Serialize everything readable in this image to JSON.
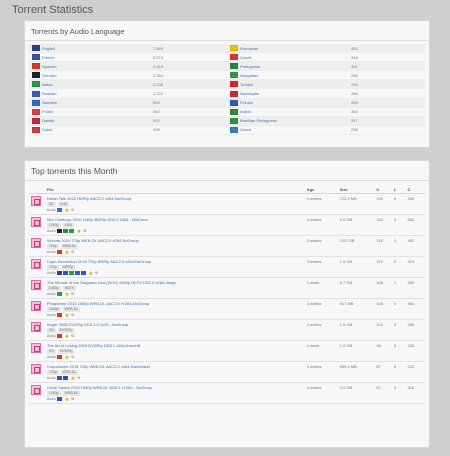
{
  "page": {
    "title": "Torrent Statistics"
  },
  "audio_panel": {
    "title": "Torrents by Audio Language",
    "left": [
      {
        "name": "English",
        "count": "7,969",
        "flag": "en"
      },
      {
        "name": "French",
        "count": "5,574",
        "flag": "fr"
      },
      {
        "name": "Spanish",
        "count": "2,410",
        "flag": "es"
      },
      {
        "name": "German",
        "count": "2,264",
        "flag": "de"
      },
      {
        "name": "Italian",
        "count": "2,135",
        "flag": "it"
      },
      {
        "name": "Russian",
        "count": "1,222",
        "flag": "ru"
      },
      {
        "name": "Swedish",
        "count": "654",
        "flag": "sv"
      },
      {
        "name": "Polish",
        "count": "540",
        "flag": "pl"
      },
      {
        "name": "Danish",
        "count": "510",
        "flag": "da"
      },
      {
        "name": "Dutch",
        "count": "498",
        "flag": "nl"
      }
    ],
    "right": [
      {
        "name": "Romanian",
        "count": "455",
        "flag": "ro"
      },
      {
        "name": "Czech",
        "count": "346",
        "flag": "cs"
      },
      {
        "name": "Portuguese",
        "count": "331",
        "flag": "pt"
      },
      {
        "name": "Hungarian",
        "count": "295",
        "flag": "hu"
      },
      {
        "name": "Turkish",
        "count": "293",
        "flag": "tr"
      },
      {
        "name": "Norwegian",
        "count": "286",
        "flag": "no"
      },
      {
        "name": "Finnish",
        "count": "289",
        "flag": "fi"
      },
      {
        "name": "Arabic",
        "count": "264",
        "flag": "ar"
      },
      {
        "name": "Brazilian Portuguese",
        "count": "247",
        "flag": "br"
      },
      {
        "name": "Greek",
        "count": "235",
        "flag": "el"
      }
    ]
  },
  "top_panel": {
    "title": "Top torrents this Month",
    "columns": {
      "file": "File",
      "age": "Age",
      "size": "Size",
      "s": "S",
      "l": "L",
      "c": "C"
    },
    "audio_label": "Audio",
    "rows": [
      {
        "name": "Urban Tale 2012 HDRip AAC2.0 x264-NoGroup",
        "badges": [
          "SD",
          "XviD"
        ],
        "flags": [
          "il"
        ],
        "votes": "+8",
        "age": "2 weeks",
        "size": "722.2 MB",
        "s": "152",
        "l": "0",
        "c": "433"
      },
      {
        "name": "Sex Cowboys 2016 1080p BDRip DD2.0 x264 - MBCrew",
        "badges": [
          "1080p",
          "x264"
        ],
        "flags": [
          "de",
          "ng",
          "it"
        ],
        "votes": "+8",
        "age": "3 weeks",
        "size": "2.5 GB",
        "s": "150",
        "l": "0",
        "c": "553"
      },
      {
        "name": "Victoria 2014 720p WEB-DL AAC2.0 x264-NoGroup",
        "badges": [
          "720p",
          "WEB-DL"
        ],
        "flags": [
          "es"
        ],
        "votes": "+8",
        "age": "3 weeks",
        "size": "2.03 GB",
        "s": "116",
        "l": "0",
        "c": "462"
      },
      {
        "name": "Capri-Revolution 2018 720p BRRip AAC2.0 x264-NoGroup",
        "badges": [
          "720p",
          "BRRip"
        ],
        "flags": [
          "en",
          "fr",
          "it",
          "ru",
          "fr"
        ],
        "votes": "+8",
        "age": "3 weeks",
        "size": "1.5 GB",
        "s": "115",
        "l": "0",
        "c": "315"
      },
      {
        "name": "The Miracle of the Sargasso Sea (2019) 1080p HDTV DD2.0 x264-mega",
        "badges": [
          "1080p",
          "HDTV"
        ],
        "flags": [
          "it"
        ],
        "votes": "+8",
        "age": "1 week",
        "size": "6.7 GB",
        "s": "108",
        "l": "1",
        "c": "280"
      },
      {
        "name": "Phraptome 2016 1080p WEB-DL AAC2.0 H.264-NoGroup",
        "badges": [
          "1080p",
          "WEB-DL"
        ],
        "flags": [
          "es"
        ],
        "votes": "+8",
        "age": "3 weeks",
        "size": "917 MB",
        "s": "105",
        "l": "0",
        "c": "464"
      },
      {
        "name": "Anger 2008 DVDRip DD5.1.0 XviD - NoGroup",
        "badges": [
          "SD",
          "DVDRip"
        ],
        "flags": [
          "es"
        ],
        "votes": "+8",
        "age": "4 weeks",
        "size": "1.5 GB",
        "s": "101",
        "l": "0",
        "c": "355"
      },
      {
        "name": "The Art of Losing 2004 DVDRip DD5.1 x264-thornhill",
        "badges": [
          "SD",
          "DVDRip"
        ],
        "flags": [
          "es"
        ],
        "votes": "+8",
        "age": "1 week",
        "size": "1.4 GB",
        "s": "98",
        "l": "0",
        "c": "233"
      },
      {
        "name": "Coquetuche 2018 720p WEB-DL AAC2.0 x264-Sammabel",
        "badges": [
          "720p",
          "WEB-DL"
        ],
        "flags": [
          "fr",
          "fr"
        ],
        "votes": "+8",
        "age": "3 weeks",
        "size": "659.1 MB",
        "s": "87",
        "l": "0",
        "c": "233"
      },
      {
        "name": "Uncle Sasha 2018 1080p WEB-DL DD5.1 H.264 - NoGroup",
        "badges": [
          "1080p",
          "WEB-DL"
        ],
        "flags": [
          "fr"
        ],
        "votes": "+8",
        "age": "4 weeks",
        "size": "3.5 GB",
        "s": "87",
        "l": "0",
        "c": "316"
      }
    ]
  },
  "flag_colors": {
    "en": "#2a3f8f",
    "fr": "#3553a8",
    "es": "#d63a2a",
    "de": "#222222",
    "it": "#2a9a4a",
    "ru": "#3a5cc0",
    "sv": "#2d6db5",
    "pl": "#d8404a",
    "da": "#c8283a",
    "nl": "#c84040",
    "ro": "#f2c200",
    "cs": "#d33",
    "pt": "#1e8a3a",
    "hu": "#3a9a4a",
    "tr": "#d8282a",
    "no": "#c8283a",
    "fi": "#2d5fae",
    "ar": "#2c8a3a",
    "br": "#2a9a3a",
    "el": "#3c78c8",
    "il": "#3b6fcf",
    "ng": "#2e8b3a"
  }
}
